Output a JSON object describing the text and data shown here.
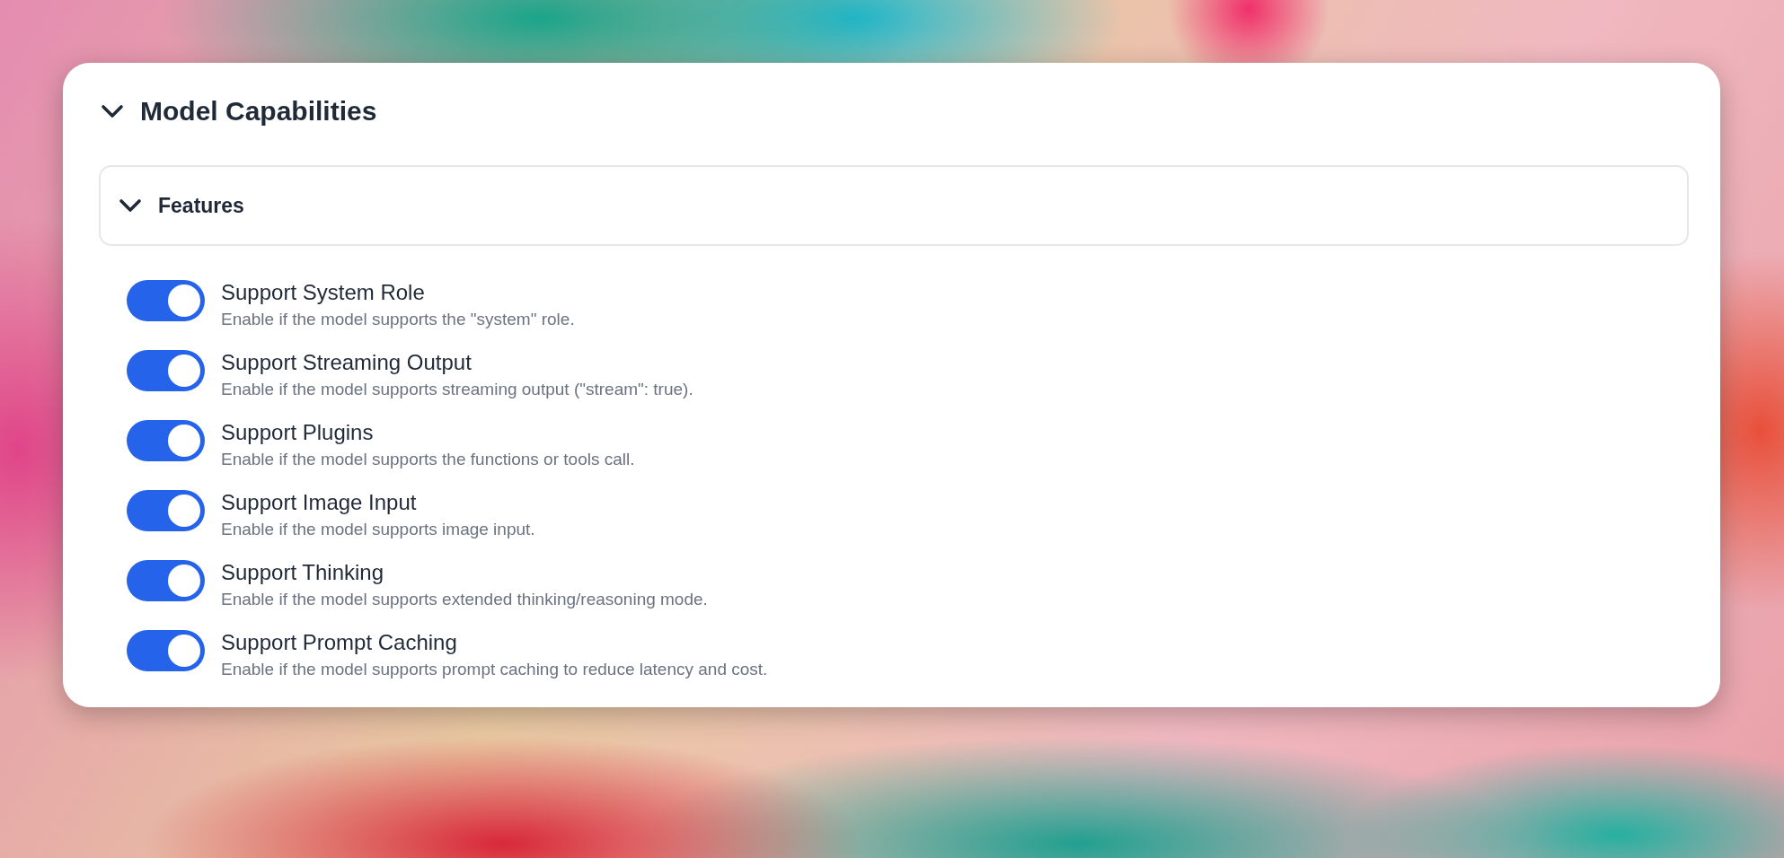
{
  "panel": {
    "title": "Model Capabilities",
    "expanded": true,
    "group": {
      "title": "Features",
      "expanded": true
    },
    "options": [
      {
        "label": "Support System Role",
        "description": "Enable if the model supports the \"system\" role.",
        "on": true
      },
      {
        "label": "Support Streaming Output",
        "description": "Enable if the model supports streaming output (\"stream\": true).",
        "on": true
      },
      {
        "label": "Support Plugins",
        "description": "Enable if the model supports the functions or tools call.",
        "on": true
      },
      {
        "label": "Support Image Input",
        "description": "Enable if the model supports image input.",
        "on": true
      },
      {
        "label": "Support Thinking",
        "description": "Enable if the model supports extended thinking/reasoning mode.",
        "on": true
      },
      {
        "label": "Support Prompt Caching",
        "description": "Enable if the model supports prompt caching to reduce latency and cost.",
        "on": true
      }
    ]
  }
}
